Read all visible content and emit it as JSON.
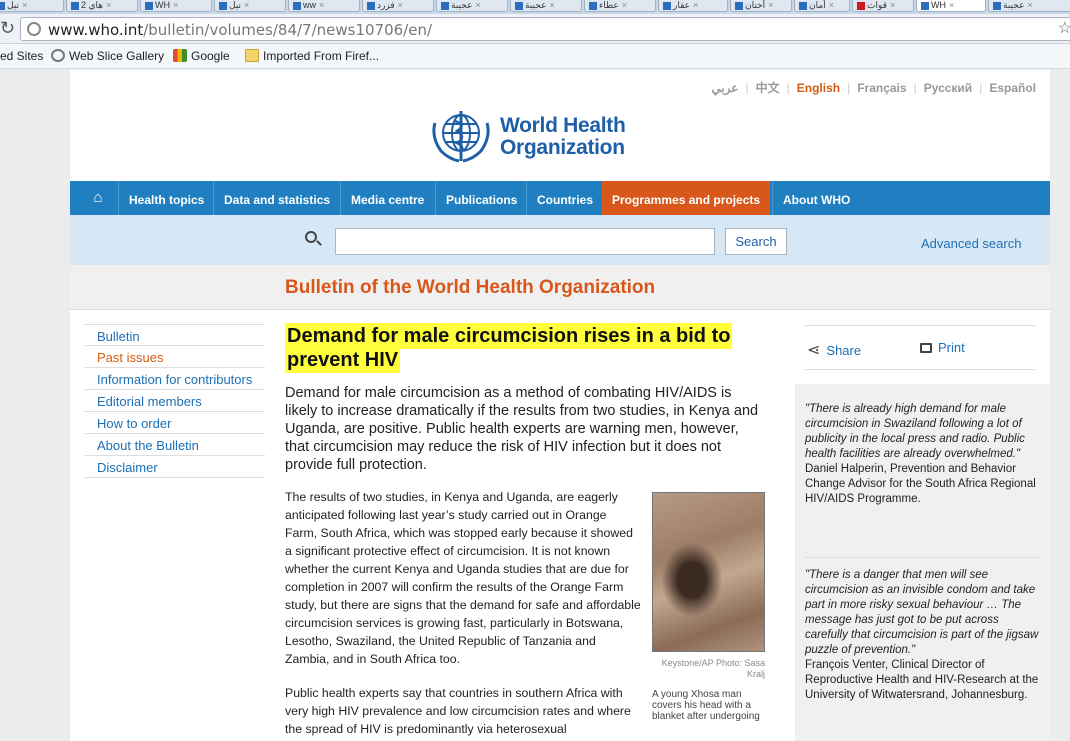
{
  "browser": {
    "tabs": [
      {
        "label": "نيل"
      },
      {
        "label": "هاي 2"
      },
      {
        "label": "WH"
      },
      {
        "label": "نيل"
      },
      {
        "label": "ww"
      },
      {
        "label": "فزرد"
      },
      {
        "label": "عجيبة"
      },
      {
        "label": "عجيبة"
      },
      {
        "label": "عطاء"
      },
      {
        "label": "عقار"
      },
      {
        "label": "أختان"
      },
      {
        "label": "أمان"
      },
      {
        "label": "قوات"
      },
      {
        "label": "WH"
      },
      {
        "label": "عجيبة"
      }
    ],
    "url_host": "www.who.int",
    "url_path": "/bulletin/volumes/84/7/news10706/en/",
    "bookmarks": [
      "ed Sites",
      "Web Slice Gallery",
      "Google",
      "Imported From Firef..."
    ]
  },
  "languages": {
    "items": [
      "عربي",
      "中文",
      "English",
      "Français",
      "Русский",
      "Español"
    ],
    "current": "English"
  },
  "logo": {
    "line1": "World Health",
    "line2": "Organization"
  },
  "nav": {
    "items": [
      "Health topics",
      "Data and statistics",
      "Media centre",
      "Publications",
      "Countries",
      "Programmes and projects",
      "About WHO"
    ],
    "active": "Programmes and projects"
  },
  "search": {
    "value": "",
    "button_label": "Search",
    "advanced_label": "Advanced search"
  },
  "bulletin_title": "Bulletin of the World Health Organization",
  "sidenav": {
    "items": [
      "Bulletin",
      "Past issues",
      "Information for contributors",
      "Editorial members",
      "How to order",
      "About the Bulletin",
      "Disclaimer"
    ],
    "current": "Past issues"
  },
  "article": {
    "headline": "Demand for male circumcision rises in a bid to prevent HIV",
    "lede": "Demand for male circumcision as a method of combating HIV/AIDS is likely to increase dramatically if the results from two studies, in Kenya and Uganda, are positive. Public health experts are warning men, however, that circumcision may reduce the risk of HIV infection but it does not provide full protection.",
    "para1": "The results of two studies, in Kenya and Uganda, are eagerly anticipated following last year’s study carried out in Orange Farm, South Africa, which was stopped early because it showed a significant protective effect of circumcision. It is not known whether the current Kenya and Uganda studies that are due for completion in 2007 will confirm the results of the Orange Farm study, but there are signs that the demand for safe and affordable circumcision services is growing fast, particularly in Botswana, Lesotho, Swaziland, the United Republic of Tanzania and Zambia, and in South Africa too.",
    "para2": "Public health experts say that countries in southern Africa with very high HIV prevalence and low circumcision rates and where the spread of HIV is predominantly via heterosexual",
    "photo_credit": "Keystone/AP Photo: Sasa Kralj",
    "photo_caption": "A young Xhosa man covers his head with a blanket after undergoing"
  },
  "tools": {
    "share": "Share",
    "print": "Print"
  },
  "quotes": [
    {
      "text": "\"There is already high demand for male circumcision in Swaziland following a lot of publicity in the local press and radio. Public health facilities are already overwhelmed.\"",
      "attribution": "Daniel Halperin, Prevention and Behavior Change Advisor for the South Africa Regional HIV/AIDS Programme."
    },
    {
      "text": "\"There is a danger that men will see circumcision as an invisible condom and take part in more risky sexual behaviour … The message has just got to be put across carefully that circumcision is part of the jigsaw puzzle of prevention.\"",
      "attribution": "François Venter, Clinical Director of Reproductive Health and HIV-Research at the University of Witwatersrand, Johannesburg."
    }
  ],
  "colors": {
    "nav_blue": "#1f7fc0",
    "nav_active_orange": "#d8571b",
    "headline_highlight": "#ffff3c",
    "link_blue": "#1e6fb5",
    "who_blue": "#1e5fa8"
  }
}
